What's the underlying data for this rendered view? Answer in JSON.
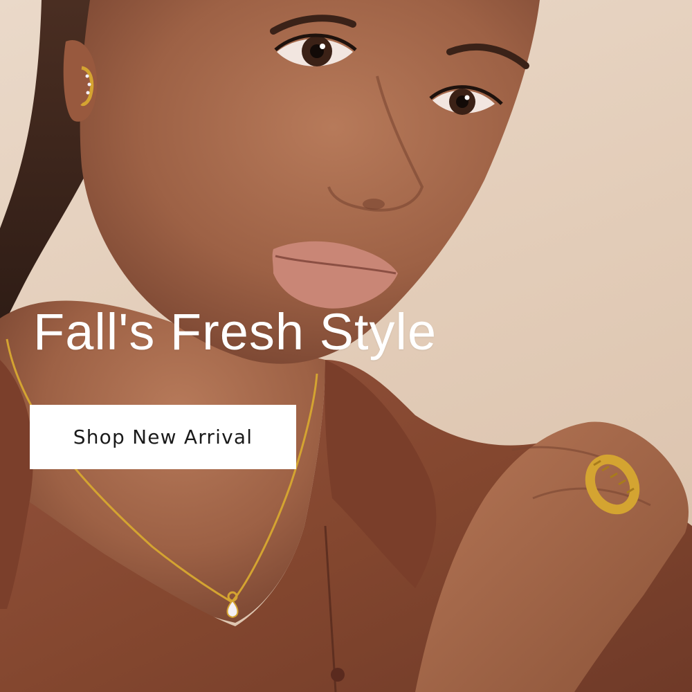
{
  "hero": {
    "headline": "Fall's Fresh Style",
    "cta_label": "Shop New Arrival"
  },
  "colors": {
    "background": "#e6d2c0",
    "skin": "#a86a4c",
    "shirt": "#8a4a36",
    "gold": "#d4a431",
    "text_on_image": "#ffffff",
    "cta_background": "#ffffff",
    "cta_text": "#1a1a1a"
  }
}
